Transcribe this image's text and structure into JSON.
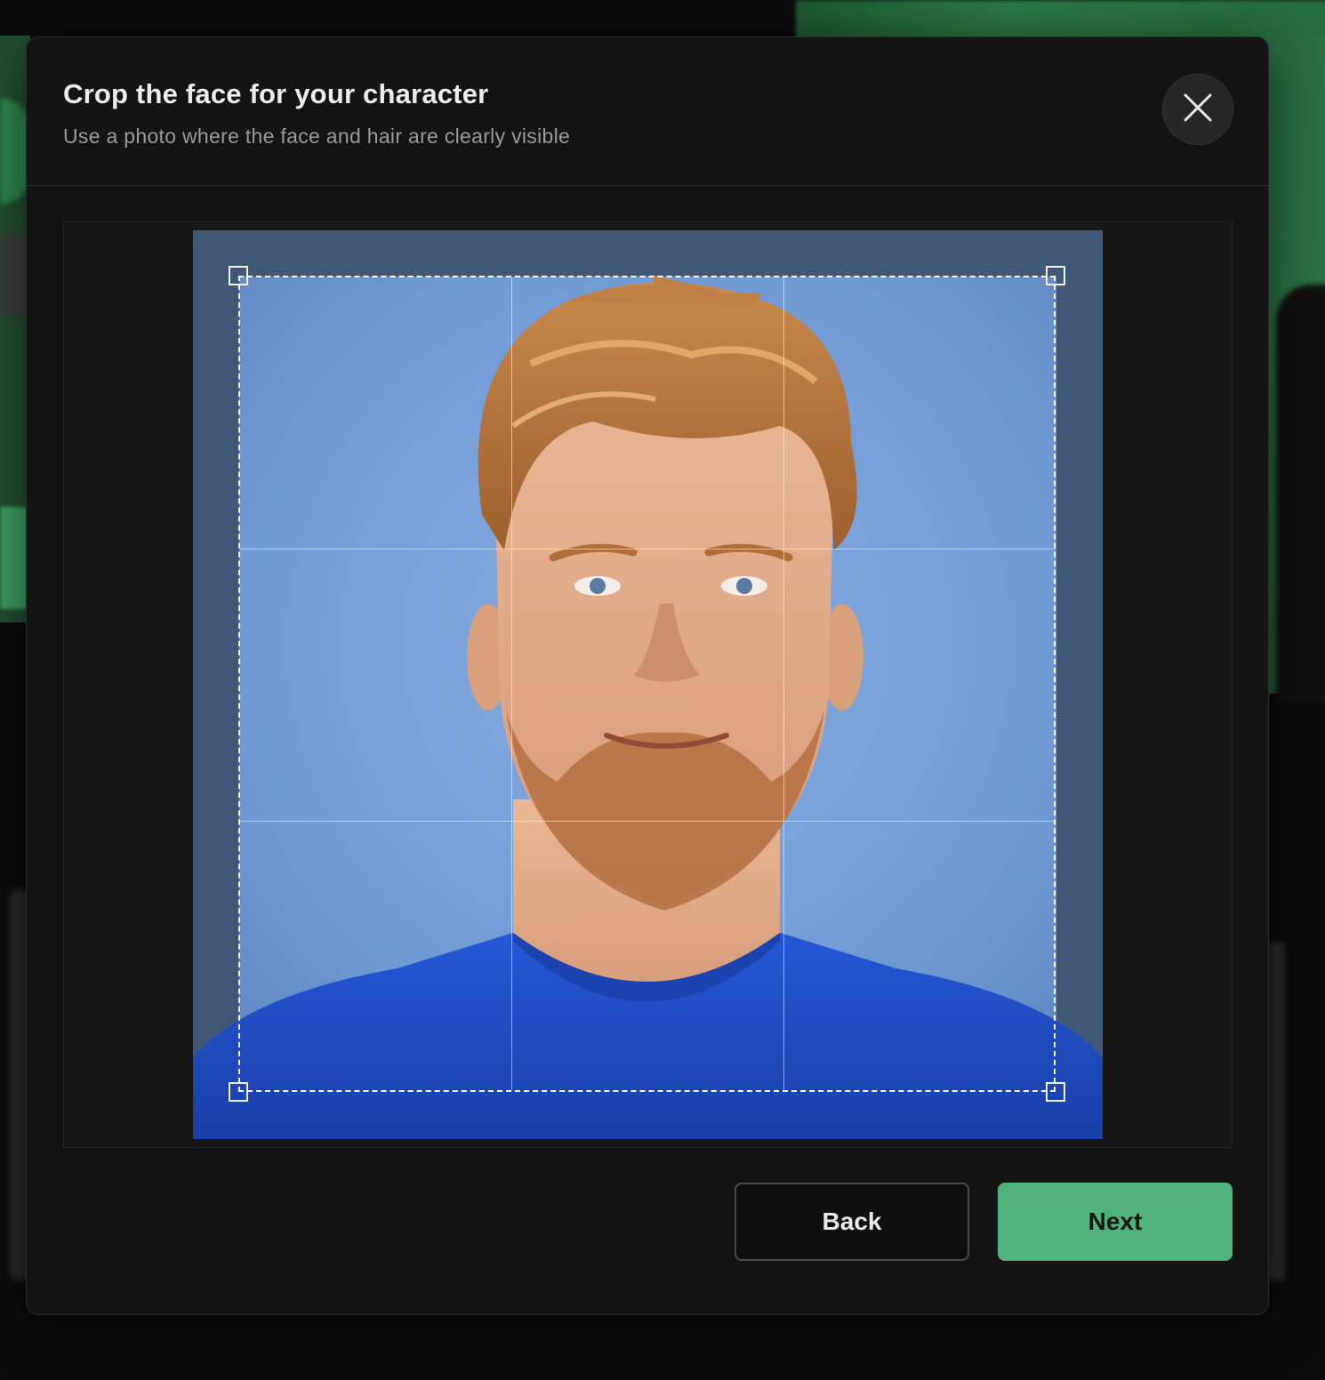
{
  "modal": {
    "title": "Crop the face for your character",
    "subtitle": "Use a photo where the face and hair are clearly visible",
    "close_icon": "close-icon"
  },
  "crop": {
    "grid": "3x3",
    "handles": [
      "top-left",
      "top-right",
      "bottom-left",
      "bottom-right"
    ]
  },
  "footer": {
    "back_label": "Back",
    "next_label": "Next"
  },
  "colors": {
    "modal_bg": "#141414",
    "accent": "#52b27e",
    "photo_bg": "#7aa0d6",
    "shirt": "#1f4fc8"
  }
}
